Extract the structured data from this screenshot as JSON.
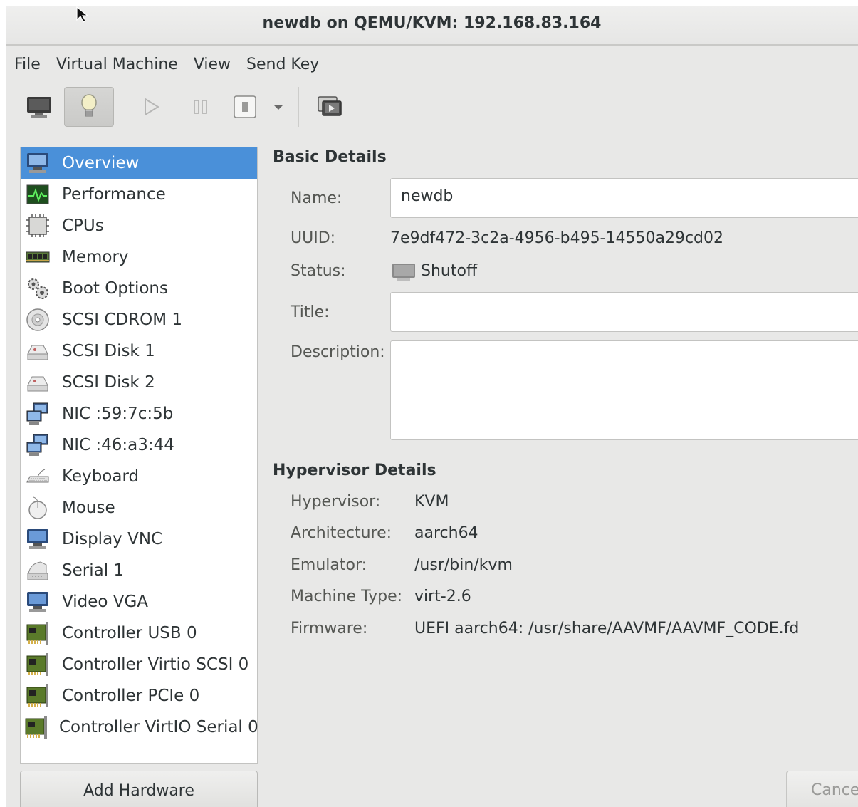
{
  "window": {
    "title": "newdb on QEMU/KVM: 192.168.83.164"
  },
  "menubar": {
    "items": [
      "File",
      "Virtual Machine",
      "View",
      "Send Key"
    ]
  },
  "toolbar": {
    "buttons": [
      {
        "icon": "monitor-icon",
        "label": "Show the graphical console"
      },
      {
        "icon": "lightbulb-icon",
        "label": "Show virtual hardware details"
      },
      {
        "icon": "play-icon",
        "label": "Run"
      },
      {
        "icon": "pause-icon",
        "label": "Pause"
      },
      {
        "icon": "shutdown-icon",
        "label": "Shut down"
      },
      {
        "icon": "dropdown-arrow-icon",
        "label": "Shutdown options"
      },
      {
        "icon": "snapshot-icon",
        "label": "Manage snapshots"
      }
    ]
  },
  "sidebar": {
    "items": [
      {
        "label": "Overview",
        "icon": "monitor-icon",
        "selected": true
      },
      {
        "label": "Performance",
        "icon": "performance-graph-icon"
      },
      {
        "label": "CPUs",
        "icon": "cpu-chip-icon"
      },
      {
        "label": "Memory",
        "icon": "memory-module-icon"
      },
      {
        "label": "Boot Options",
        "icon": "gears-icon"
      },
      {
        "label": "SCSI CDROM 1",
        "icon": "cdrom-icon"
      },
      {
        "label": "SCSI Disk 1",
        "icon": "hard-disk-icon"
      },
      {
        "label": "SCSI Disk 2",
        "icon": "hard-disk-icon"
      },
      {
        "label": "NIC :59:7c:5b",
        "icon": "network-icon"
      },
      {
        "label": "NIC :46:a3:44",
        "icon": "network-icon"
      },
      {
        "label": "Keyboard",
        "icon": "keyboard-icon"
      },
      {
        "label": "Mouse",
        "icon": "mouse-icon"
      },
      {
        "label": "Display VNC",
        "icon": "display-icon"
      },
      {
        "label": "Serial 1",
        "icon": "serial-icon"
      },
      {
        "label": "Video VGA",
        "icon": "display-icon"
      },
      {
        "label": "Controller USB 0",
        "icon": "controller-card-icon"
      },
      {
        "label": "Controller Virtio SCSI 0",
        "icon": "controller-card-icon"
      },
      {
        "label": "Controller PCIe 0",
        "icon": "controller-card-icon"
      },
      {
        "label": "Controller VirtIO Serial 0",
        "icon": "controller-card-icon"
      }
    ],
    "add_hardware_label": "Add Hardware"
  },
  "basic_details": {
    "heading": "Basic Details",
    "name_label": "Name:",
    "name_value": "newdb",
    "uuid_label": "UUID:",
    "uuid_value": "7e9df472-3c2a-4956-b495-14550a29cd02",
    "status_label": "Status:",
    "status_value": "Shutoff",
    "title_label": "Title:",
    "title_value": "",
    "description_label": "Description:",
    "description_value": ""
  },
  "hypervisor_details": {
    "heading": "Hypervisor Details",
    "hypervisor_label": "Hypervisor:",
    "hypervisor_value": "KVM",
    "architecture_label": "Architecture:",
    "architecture_value": "aarch64",
    "emulator_label": "Emulator:",
    "emulator_value": "/usr/bin/kvm",
    "machine_type_label": "Machine Type:",
    "machine_type_value": "virt-2.6",
    "firmware_label": "Firmware:",
    "firmware_value": "UEFI aarch64: /usr/share/AAVMF/AAVMF_CODE.fd"
  },
  "footer": {
    "cancel_label": "Cance"
  },
  "colors": {
    "selection": "#4a90d9",
    "window_bg": "#e8e8e7"
  }
}
